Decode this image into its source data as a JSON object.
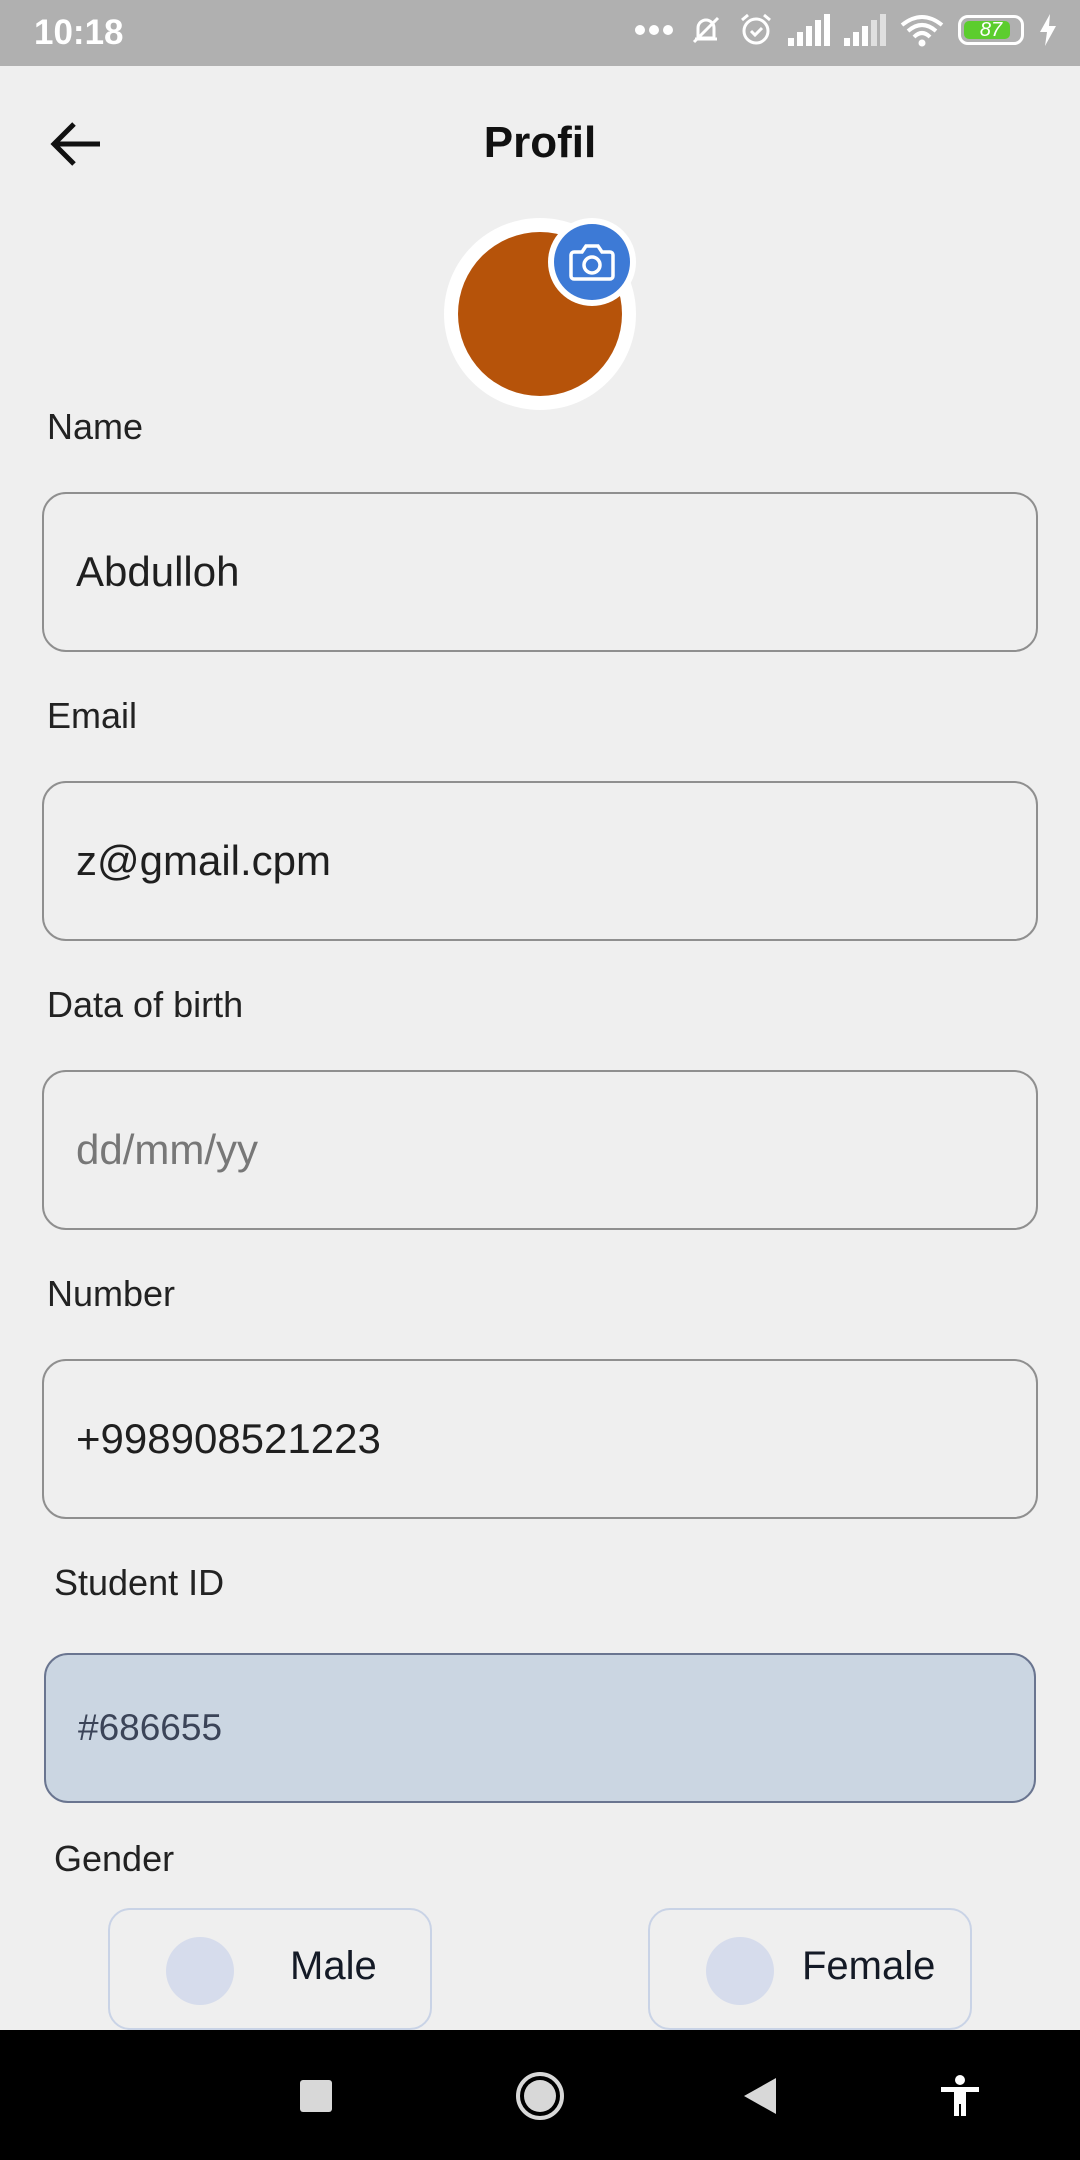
{
  "status_bar": {
    "time": "10:18",
    "battery_level": 87,
    "battery_text": "87",
    "icons": [
      "more-dots-icon",
      "bell-off-icon",
      "alarm-icon",
      "signal-icon",
      "signal-icon",
      "wifi-icon",
      "battery-icon",
      "charging-icon"
    ]
  },
  "header": {
    "title": "Profil",
    "back_icon": "arrow-left-icon"
  },
  "avatar": {
    "color": "#b6530a",
    "camera_icon": "camera-icon",
    "camera_color": "#3d7ad6"
  },
  "form": {
    "name": {
      "label": "Name",
      "value": "Abdulloh"
    },
    "email": {
      "label": "Email",
      "value": "z@gmail.cpm"
    },
    "dob": {
      "label": "Data of birth",
      "value": "",
      "placeholder": "dd/mm/yy"
    },
    "number": {
      "label": "Number",
      "value": "+998908521223"
    },
    "student_id": {
      "label": "Student ID",
      "value": "#686655"
    },
    "gender": {
      "label": "Gender",
      "options": [
        {
          "label": "Male",
          "selected": false
        },
        {
          "label": "Female",
          "selected": false
        }
      ]
    }
  },
  "nav_bar": {
    "items": [
      "recents-square-icon",
      "home-circle-icon",
      "back-triangle-icon",
      "accessibility-icon"
    ]
  }
}
